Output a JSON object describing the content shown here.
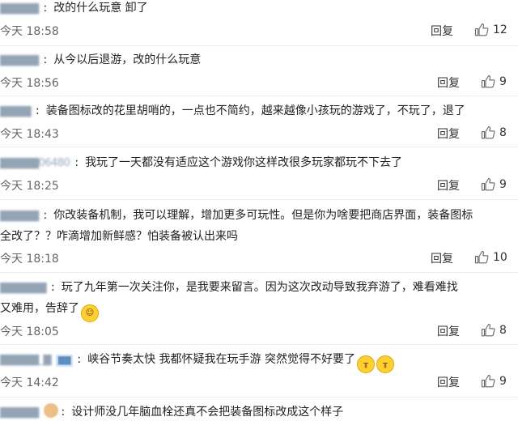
{
  "reply_label": "回复",
  "comments": [
    {
      "user": "▇▇▇▇▇",
      "text": "改的什么玩意  卸了",
      "time": "今天 18:58",
      "likes": "12"
    },
    {
      "user": "▇▇▇▇▇",
      "text": "从今以后退游，改的什么玩意",
      "time": "今天 18:56",
      "likes": "9"
    },
    {
      "user": "▇▇▇▇",
      "text": "装备图标改的花里胡哨的，一点也不简约，越来越像小孩玩的游戏了，不玩了，退了",
      "time": "今天 18:43",
      "likes": "8"
    },
    {
      "user": "▇▇▇▇▇06480",
      "text": "我玩了一天都没有适应这个游戏你这样改很多玩家都玩不下去了",
      "time": "今天 18:25",
      "likes": "9"
    },
    {
      "user": "▇▇▇▇▇",
      "text": "你改装备机制，我可以理解，增加更多可玩性。但是你为啥要把商店界面，装备图标",
      "text2": "全改了？？咋滴增加新鲜感？怕装备被认出来吗",
      "time": "今天 18:18",
      "likes": "10"
    },
    {
      "user": "▇▇▇▇▇▇",
      "text": "玩了九年第一次关注你，是我要来留言。因为这次改动导致我弃游了，难看难找",
      "text2": "又难用，告辞了",
      "time": "今天 18:05",
      "likes": "8"
    },
    {
      "user": "▇▇▇▇▇_▇",
      "badge": "▇▇",
      "text": "峡谷节奏太快  我都怀疑我在玩手游  突然觉得不好要了",
      "time": "今天 14:42",
      "likes": "9"
    },
    {
      "user": "▇▇▇▇▇",
      "text": "设计师没几年脑血栓还真不会把装备图标改成这个样子"
    }
  ]
}
